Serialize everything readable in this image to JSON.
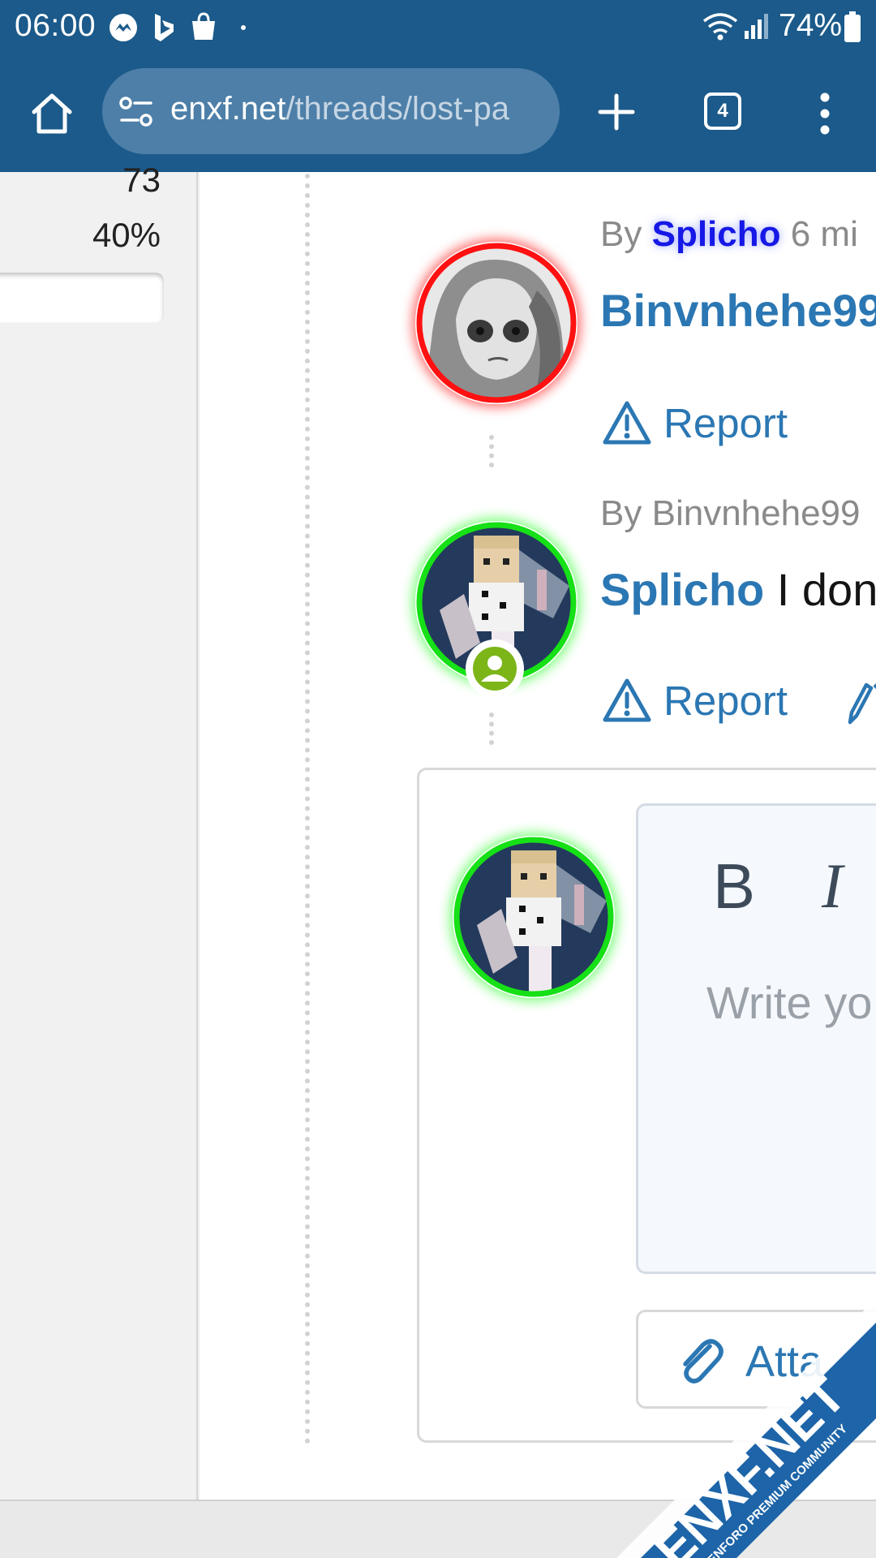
{
  "status_bar": {
    "time": "06:00",
    "battery": "74%",
    "notification_icons": [
      "messenger-icon",
      "bing-icon",
      "shopping-bag-icon",
      "dot-icon"
    ],
    "system_icons": [
      "wifi-icon",
      "signal-icon",
      "battery-icon"
    ]
  },
  "browser": {
    "url_host": "enxf.net",
    "url_path": "/threads/lost-pa",
    "tab_count": "4",
    "toolbar_color": "#1b5a8a"
  },
  "sidebar": {
    "count": "73",
    "percent": "40%",
    "poll_fill": 0.4
  },
  "posts": [
    {
      "meta_prefix": "By",
      "meta_user": "Splicho",
      "meta_time": "6 mi",
      "author": "Binvnhehe99",
      "text": "",
      "report_label": "Report",
      "ring_color": "#ff1111"
    },
    {
      "meta_prefix": "By",
      "meta_user": "Binvnhehe99",
      "author": "Splicho",
      "text": " I don",
      "report_label": "Report",
      "ring_color": "#16e016"
    }
  ],
  "reply": {
    "bold_label": "B",
    "italic_label": "I",
    "placeholder": "Write yo",
    "attach_label": "Atta"
  },
  "watermark": {
    "brand": "ENXF.NET",
    "tagline": "XENFORO PREMIUM COMMUNITY"
  },
  "colors": {
    "link": "#2b77b3",
    "highlight_user": "#1518e6",
    "online_ring": "#16e016",
    "banned_ring": "#ff1111"
  }
}
